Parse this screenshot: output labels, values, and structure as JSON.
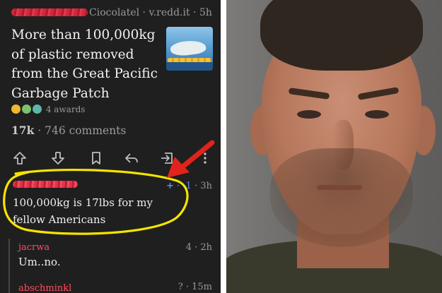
{
  "post": {
    "meta": "Ciocolatel · v.redd.it · 5h",
    "title": "More than 100,000kg of plastic removed from the Great Pacific Garbage Patch",
    "awards_label": "4 awards",
    "score": "17k",
    "comments_label": "· 746 comments"
  },
  "actions": [
    "upvote-icon",
    "downvote-icon",
    "bookmark-icon",
    "reply-icon",
    "share-icon",
    "more-icon"
  ],
  "comment": {
    "score_plus": "+",
    "score": "· -1",
    "age": "· 3h",
    "body": "100,000kg is 17lbs for my fellow Americans"
  },
  "replies": [
    {
      "user": "jacrwa",
      "score": "4 · 2h",
      "body": "Um..no."
    },
    {
      "user": "abschminkl",
      "score": "? · 15m"
    }
  ],
  "colors": {
    "highlight_circle": "#f5e400",
    "arrow": "#e0241b",
    "username": "#ff4f5e",
    "background": "#1f1f1f"
  }
}
